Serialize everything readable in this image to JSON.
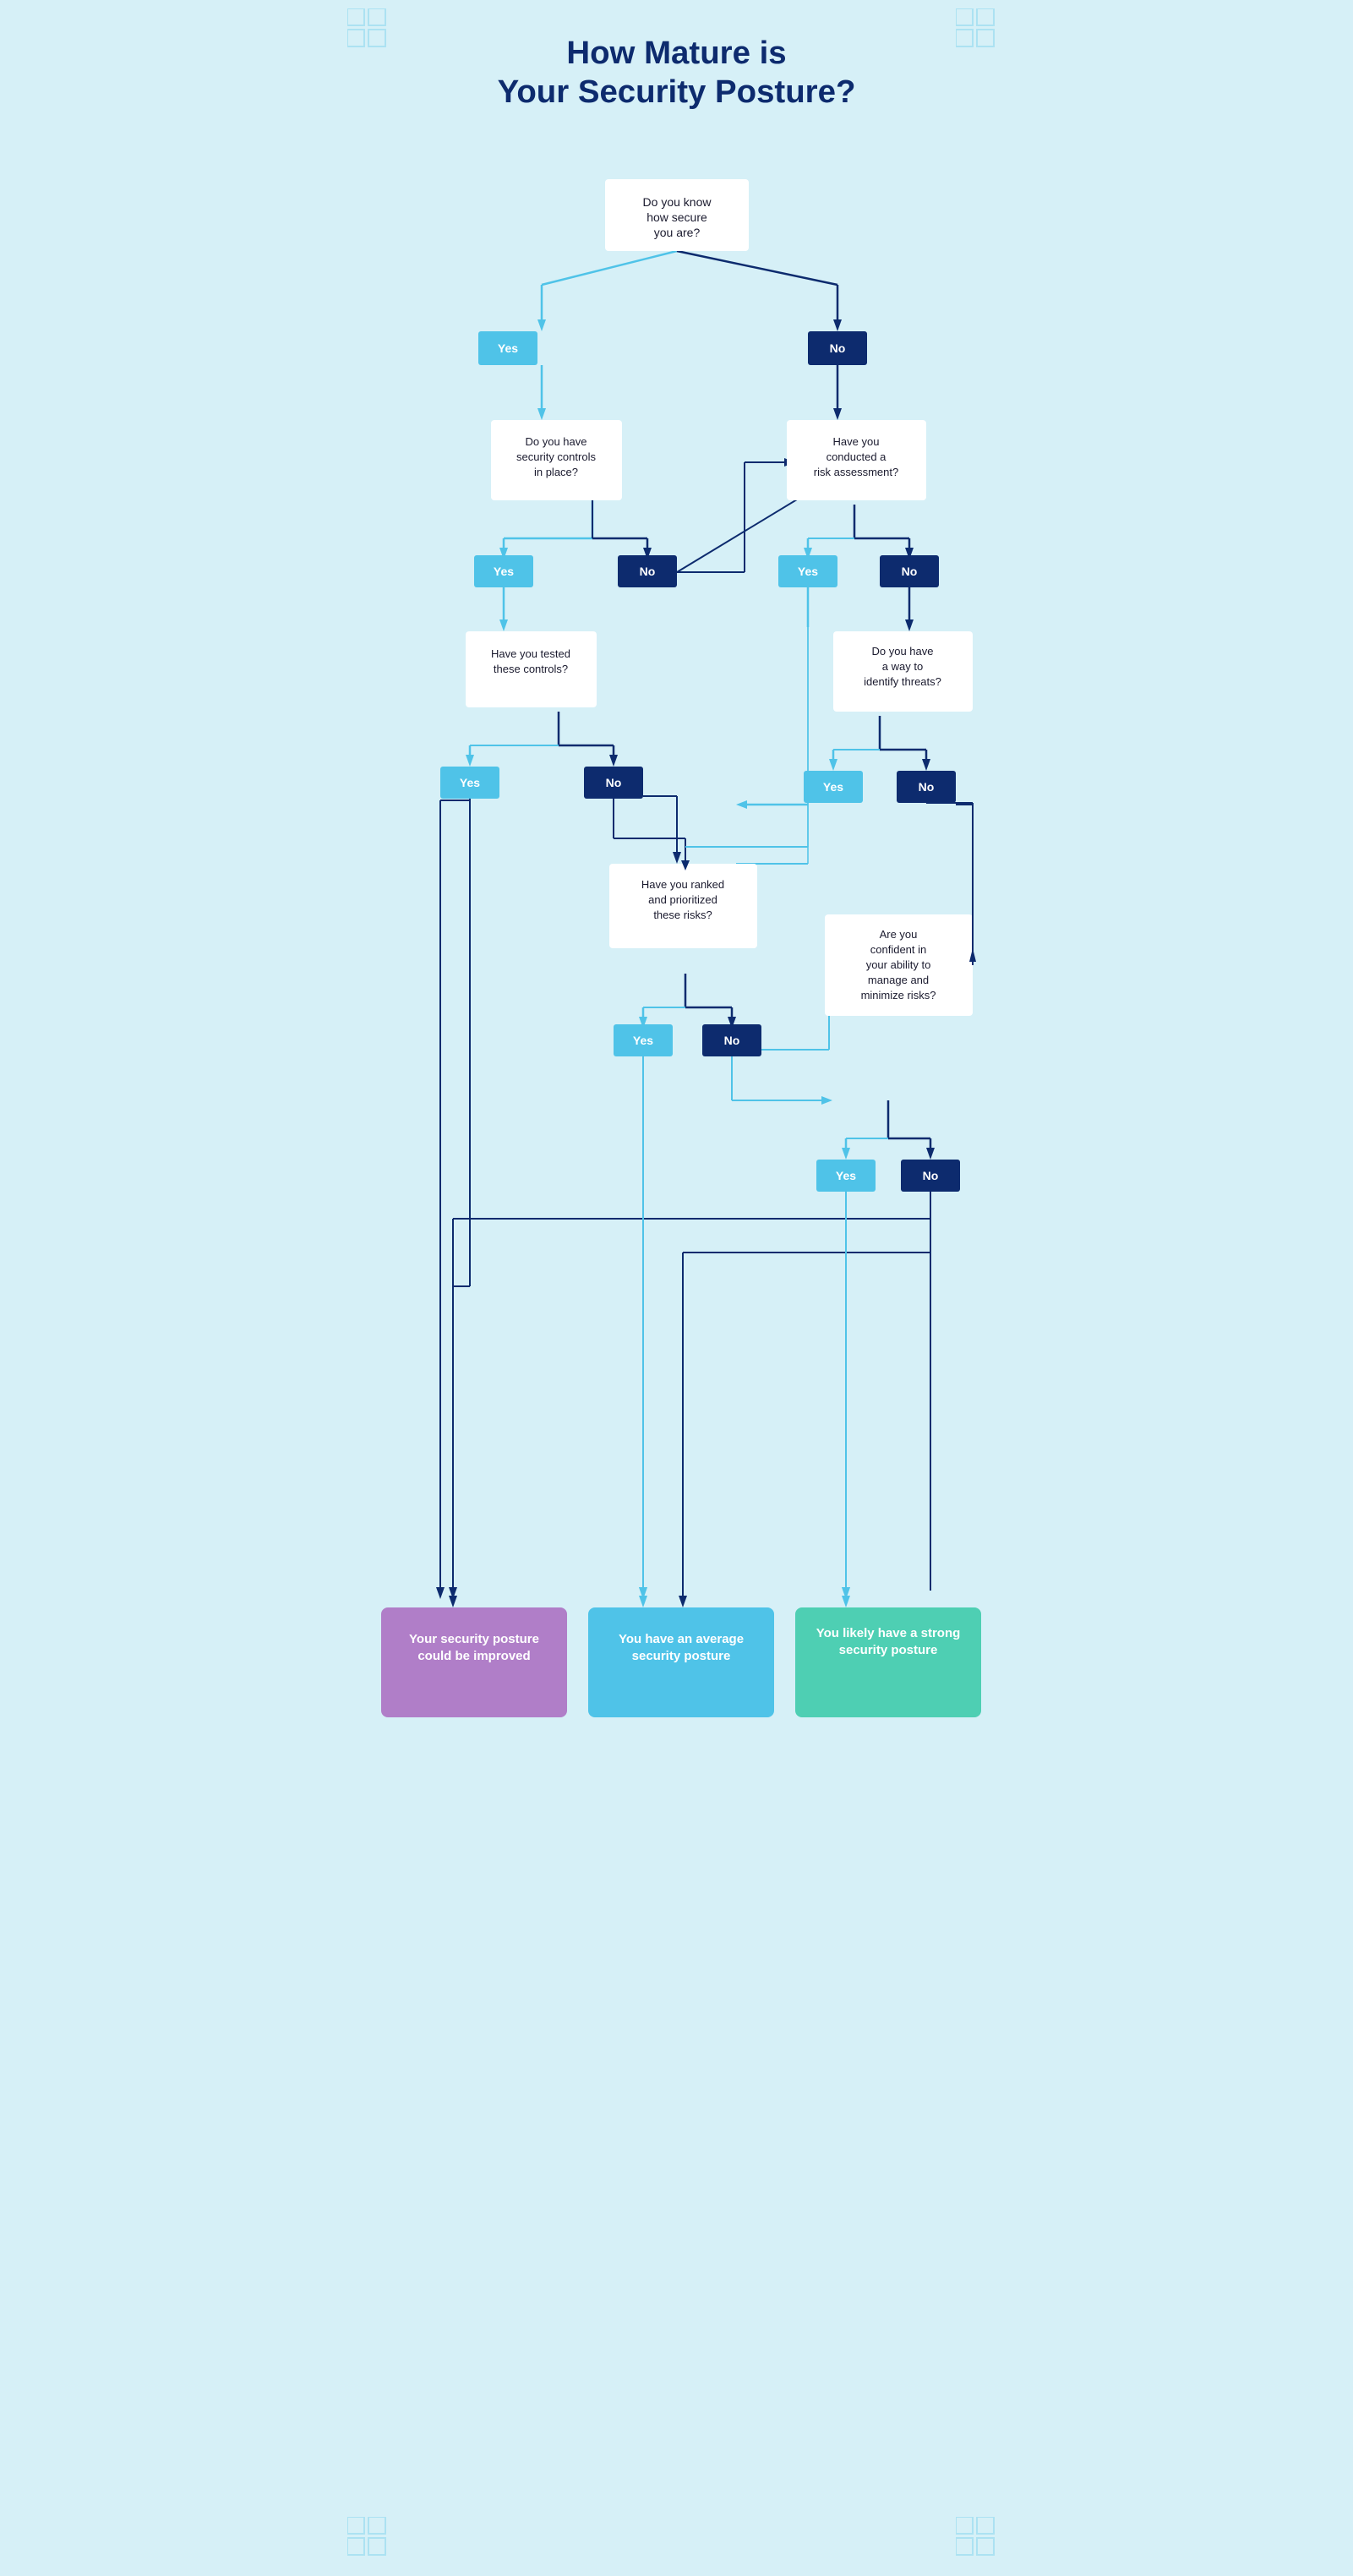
{
  "title": {
    "line1": "How Mature is",
    "line2": "Your Security Posture?"
  },
  "questions": {
    "q1": "Do you know\nhow secure\nyou are?",
    "q2": "Do you have\nsecurity controls\nin place?",
    "q3": "Have you conducted a\nrisk assessment?",
    "q4": "Have you tested\nthese controls?",
    "q5": "Do you have\na way to\nidentify threats?",
    "q6": "Have you ranked\nand prioritized\nthese risks?",
    "q7": "Are you\nconfident in\nyour ability to\nmanage and\nminimize risks?"
  },
  "answers": {
    "yes": "Yes",
    "no": "No"
  },
  "outcomes": {
    "poor": "Your security posture could be improved",
    "average": "You have an average security posture",
    "strong": "You likely have a strong security posture"
  },
  "colors": {
    "background": "#d6f0f7",
    "title": "#0d2b6e",
    "qbox_bg": "#ffffff",
    "yes_bg": "#4fc3e8",
    "no_bg": "#0d2b6e",
    "arrow_light": "#4fc3e8",
    "arrow_dark": "#0d2b6e",
    "outcome_purple": "#b07ec8",
    "outcome_blue": "#4fc3e8",
    "outcome_teal": "#4ecfb3"
  }
}
